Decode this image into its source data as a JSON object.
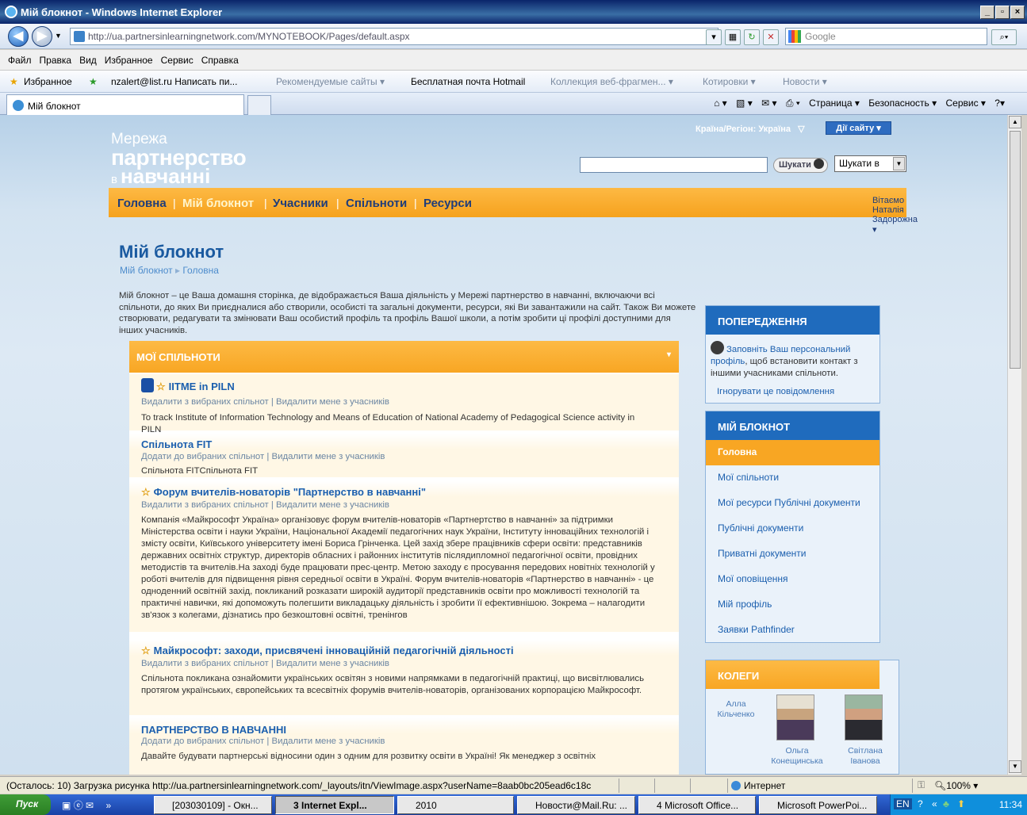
{
  "window": {
    "title": "Мій блокнот - Windows Internet Explorer",
    "controls": [
      "_",
      "▫",
      "×"
    ]
  },
  "address": {
    "url": "http://ua.partnersinlearningnetwork.com/MYNOTEBOOK/Pages/default.aspx",
    "search_placeholder": "Google"
  },
  "menu": [
    "Файл",
    "Правка",
    "Вид",
    "Избранное",
    "Сервис",
    "Справка"
  ],
  "favorites": {
    "label": "Избранное",
    "items": [
      "nzalert@list.ru Написать пи...",
      "Рекомендуемые сайты ▾",
      "Бесплатная почта Hotmail",
      "Коллекция веб-фрагмен... ▾",
      "Котировки ▾",
      "Новости ▾"
    ]
  },
  "tab": {
    "title": "Мій блокнот"
  },
  "commandbar": [
    "Страница ▾",
    "Безопасность ▾",
    "Сервис ▾"
  ],
  "site": {
    "logo_line1": "Мережа",
    "logo_line2": "партнерство",
    "logo_line3_small": "в",
    "logo_line3": "навчанні",
    "country": "Країна/Регіон: Україна",
    "site_actions": "Дії сайту ▾",
    "search_button": "Шукати",
    "search_scope": "Шукати в",
    "nav": [
      "Головна",
      "Мій блокнот",
      "Учасники",
      "Спільноти",
      "Ресурси"
    ],
    "greeting": "Вітаємо Наталія Задорожна ▾"
  },
  "page": {
    "title": "Мій блокнот",
    "breadcrumb_1": "Мій блокнот",
    "breadcrumb_2": "Головна",
    "intro": "Мій блокнот – це Ваша домашня сторінка, де відображається Ваша  діяльність у Мережі партнерство в навчанні, включаючи всі спільноти, до яких Ви приєдналися або створили, особисті та загальні документи, ресурси, які Ви завантажили на сайт. Також Ви можете створювати, редагувати та змінювати Ваш особистий профіль та профіль Вашої школи, а потім зробити ці профілі доступними для інших учасників."
  },
  "communities": {
    "header": "МОЇ СПІЛЬНОТИ",
    "items": [
      {
        "title": "IITME in PILN",
        "actions": "Видалити з вибраних спільнот | Видалити мене з учасників",
        "desc": "To track Institute of Information Technology and Means of Education of National Academy of Pedagogical Science activity in PILN"
      },
      {
        "title": "Спільнота FIT",
        "actions": "Додати до вибраних спільнот | Видалити мене з учасників",
        "desc": "Спільнота FITСпільнота FIT"
      },
      {
        "title": "Форум вчителів-новаторів \"Партнерство в навчанні\"",
        "actions": "Видалити з вибраних спільнот | Видалити мене з учасників",
        "desc": "Компанія «Майкрософт Україна» організовує форум вчителів-новаторів «Партнертство в навчанні» за підтримки Міністерства освіти і науки України, Національної Академії педагогічних наук України, Інституту інноваційних технологій і змісту освіти, Київського університету імені Бориса Грінченка. Цей захід збере працівників сфери освіти: представників державних освітніх структур, директорів обласних і районних інститутів післядипломної педагогічної освіти, провідних методистів та вчителів.На заході буде працювати прес-центр. Метою заходу є просування передових новітніх технологій у роботі вчителів для підвищення рівня середньої освіти в Україні. Форум вчителів-новаторів «Партнерство в навчанні» - це одноденний освітній захід, покликаний розказати широкій аудиторії представників освіти про можливості технологій та практичні навички, які допоможуть полегшити викладацьку діяльність і зробити її ефективнішою. Зокрема – налагодити зв'язок з колегами, дізнатись про безкоштовні освітні, тренінгов"
      },
      {
        "title": "Майкрософт: заходи, присвячені інноваційній педагогічній діяльності",
        "actions": "Видалити з вибраних спільнот | Видалити мене з учасників",
        "desc": "Спільнота покликана ознайомити українських освітян з новими напрямками в педагогічній практиці, що висвітлювались протягом українських, європейських та всесвітніх форумів вчителів-новаторів, організованих корпорацією Майкрософт."
      },
      {
        "title": "ПАРТНЕРСТВО В НАВЧАННІ",
        "actions": "Додати до вибраних спільнот | Видалити мене з учасників",
        "desc": "Давайте будувати партнерські відносини один з одним для розвитку освіти в Україні! Як менеджер з освітніх"
      }
    ]
  },
  "warnings": {
    "header": "ПОПЕРЕДЖЕННЯ",
    "link": "Заповніть Ваш персональний профіль",
    "text": ", щоб встановити контакт з іншими учасниками спільноти.",
    "ignore": "Ігнорувати це повідомлення"
  },
  "notebook": {
    "header": "МІЙ БЛОКНОТ",
    "items": [
      "Головна",
      "Мої спільноти",
      "Мої ресурси Публічні документи",
      "Публічні документи",
      "Приватні документи",
      "Мої оповіщення",
      "Мій профіль",
      "Заявки Pathfinder"
    ]
  },
  "colleagues": {
    "header": "КОЛЕГИ",
    "people": [
      {
        "line1": "Алла",
        "line2": "Кільченко"
      },
      {
        "line1": "Ольга",
        "line2": "Конещинська"
      },
      {
        "line1": "Світлана",
        "line2": "Іванова"
      }
    ]
  },
  "statusbar": {
    "text": "(Осталось: 10) Загрузка рисунка http://ua.partnersinlearningnetwork.com/_layouts/itn/ViewImage.aspx?userName=8aab0bc205ead6c18c",
    "zone": "Интернет",
    "zoom": "100%"
  },
  "taskbar": {
    "start": "Пуск",
    "items": [
      "[203030109] - Окн...",
      "3 Internet Expl...",
      "2010",
      "Новости@Mail.Ru: ...",
      "4 Microsoft Office...",
      "Microsoft PowerPoi..."
    ],
    "lang": "EN",
    "clock": "11:34"
  }
}
